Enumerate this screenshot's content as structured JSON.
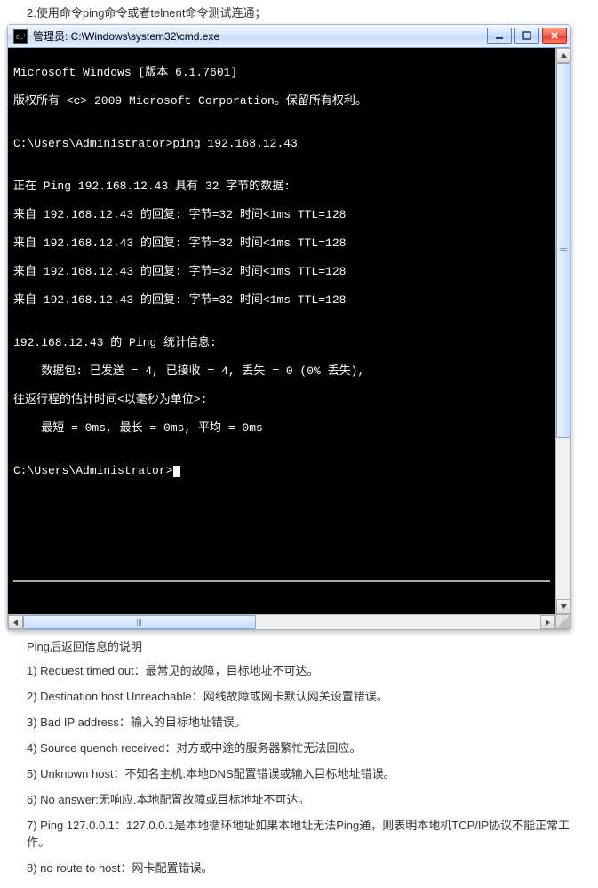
{
  "instruction": "2.使用命令ping命令或者telnent命令测试连通；",
  "window": {
    "title": "管理员: C:\\Windows\\system32\\cmd.exe"
  },
  "terminal": {
    "l1": "Microsoft Windows [版本 6.1.7601]",
    "l2": "版权所有 <c> 2009 Microsoft Corporation。保留所有权利。",
    "l3": "",
    "l4": "C:\\Users\\Administrator>ping 192.168.12.43",
    "l5": "",
    "l6": "正在 Ping 192.168.12.43 具有 32 字节的数据:",
    "l7": "来自 192.168.12.43 的回复: 字节=32 时间<1ms TTL=128",
    "l8": "来自 192.168.12.43 的回复: 字节=32 时间<1ms TTL=128",
    "l9": "来自 192.168.12.43 的回复: 字节=32 时间<1ms TTL=128",
    "l10": "来自 192.168.12.43 的回复: 字节=32 时间<1ms TTL=128",
    "l11": "",
    "l12": "192.168.12.43 的 Ping 统计信息:",
    "l13": "    数据包: 已发送 = 4, 已接收 = 4, 丢失 = 0 (0% 丢失),",
    "l14": "往返行程的估计时间<以毫秒为单位>:",
    "l15": "    最短 = 0ms, 最长 = 0ms, 平均 = 0ms",
    "l16": "",
    "prompt": "C:\\Users\\Administrator>"
  },
  "notes_title": "Ping后返回信息的说明",
  "notes": {
    "n1": "1) Request timed out：最常见的故障，目标地址不可达。",
    "n2": "2) Destination host Unreachable：网线故障或网卡默认网关设置错误。",
    "n3": "3) Bad IP address：输入的目标地址错误。",
    "n4": "4) Source quench received：对方或中途的服务器繁忙无法回应。",
    "n5": "5) Unknown host：不知名主机.本地DNS配置错误或输入目标地址错误。",
    "n6": "6) No answer:无响应.本地配置故障或目标地址不可达。",
    "n7": "7) Ping 127.0.0.1：127.0.0.1是本地循环地址如果本地址无法Ping通，则表明本地机TCP/IP协议不能正常工作。",
    "n8": "8) no route to host：网卡配置错误。"
  }
}
